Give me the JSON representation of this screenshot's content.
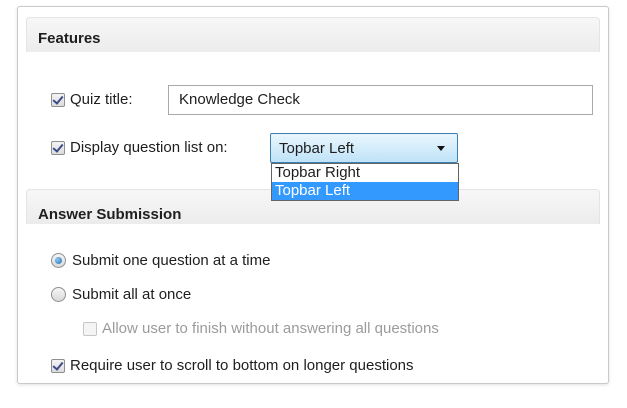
{
  "features": {
    "title": "Features",
    "quiz_title": {
      "label": "Quiz title:",
      "checked": true,
      "value": "Knowledge Check"
    },
    "question_list": {
      "label": "Display question list on:",
      "checked": true,
      "selected": "Topbar Left",
      "options": [
        "Topbar Right",
        "Topbar Left"
      ],
      "highlighted_option": "Topbar Left"
    }
  },
  "answer_submission": {
    "title": "Answer Submission",
    "submit_one": {
      "label": "Submit one question at a time",
      "selected": true
    },
    "submit_all": {
      "label": "Submit all at once",
      "selected": false
    },
    "allow_finish": {
      "label": "Allow user to finish without answering all questions",
      "checked": false,
      "disabled": true
    },
    "require_scroll": {
      "label": "Require user to scroll to bottom on longer questions",
      "checked": true
    }
  },
  "colors": {
    "selection": "#3399ff",
    "select_border": "#3c7fb1",
    "check_mark": "#3b4a8a"
  }
}
